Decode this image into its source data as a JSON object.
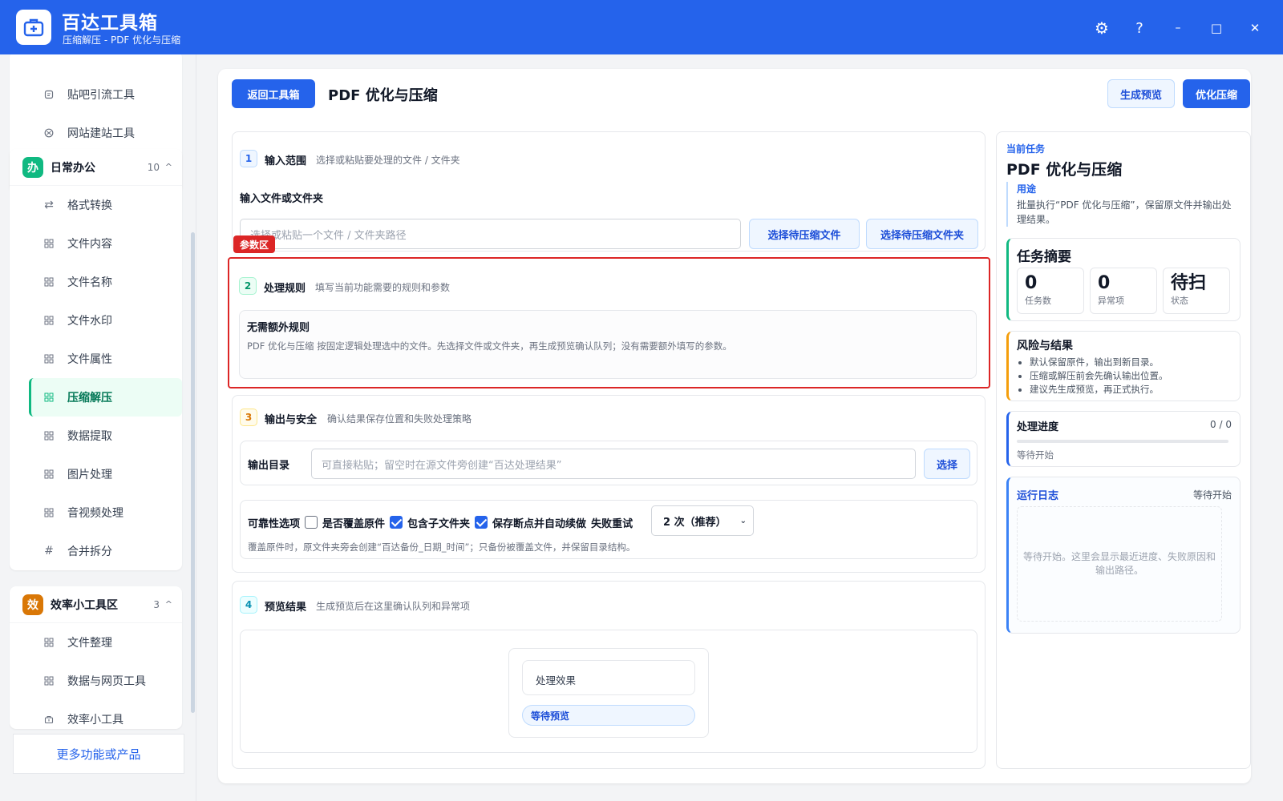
{
  "app": {
    "title": "百达工具箱",
    "subtitle": "压缩解压 - PDF 优化与压缩"
  },
  "window_controls": {
    "settings": "⚙",
    "help": "?",
    "minimize": "–",
    "maximize": "□",
    "close": "✕"
  },
  "sidebar": {
    "top_items": [
      {
        "label": "贴吧引流工具",
        "icon": "document-icon"
      },
      {
        "label": "网站建站工具",
        "icon": "globe-icon"
      }
    ],
    "groups": [
      {
        "badge": "办",
        "badge_color": "#10b981",
        "title": "日常办公",
        "count": "10",
        "chevron": "^",
        "items": [
          {
            "label": "格式转换",
            "icon": "swap-icon"
          },
          {
            "label": "文件内容",
            "icon": "grid-icon"
          },
          {
            "label": "文件名称",
            "icon": "grid-icon"
          },
          {
            "label": "文件水印",
            "icon": "grid-icon"
          },
          {
            "label": "文件属性",
            "icon": "grid-icon"
          },
          {
            "label": "压缩解压",
            "icon": "grid-icon",
            "active": true
          },
          {
            "label": "数据提取",
            "icon": "grid-icon"
          },
          {
            "label": "图片处理",
            "icon": "grid-icon"
          },
          {
            "label": "音视频处理",
            "icon": "grid-icon"
          },
          {
            "label": "合并拆分",
            "icon": "hash-icon"
          }
        ]
      },
      {
        "badge": "效",
        "badge_color": "#d97706",
        "title": "效率小工具区",
        "count": "3",
        "chevron": "^",
        "items": [
          {
            "label": "文件整理",
            "icon": "grid-icon"
          },
          {
            "label": "数据与网页工具",
            "icon": "grid-icon"
          },
          {
            "label": "效率小工具",
            "icon": "toolbox-icon"
          }
        ]
      }
    ],
    "more_label": "更多功能或产品"
  },
  "toolbar": {
    "back_label": "返回工具箱",
    "page_title": "PDF 优化与压缩",
    "preview_label": "生成预览",
    "run_label": "优化压缩"
  },
  "sections": {
    "input": {
      "num": "1",
      "title": "输入范围",
      "desc": "选择或粘贴要处理的文件 / 文件夹",
      "field_label": "输入文件或文件夹",
      "placeholder": "选择或粘贴一个文件 / 文件夹路径",
      "choose_file": "选择待压缩文件",
      "choose_folder": "选择待压缩文件夹"
    },
    "rules": {
      "tag": "参数区",
      "num": "2",
      "title": "处理规则",
      "desc": "填写当前功能需要的规则和参数",
      "box_title": "无需额外规则",
      "box_text": "PDF 优化与压缩 按固定逻辑处理选中的文件。先选择文件或文件夹，再生成预览确认队列；没有需要额外填写的参数。"
    },
    "output": {
      "num": "3",
      "title": "输出与安全",
      "desc": "确认结果保存位置和失败处理策略",
      "dir_label": "输出目录",
      "dir_placeholder": "可直接粘贴；留空时在源文件旁创建“百达处理结果”",
      "dir_button": "选择",
      "reliability_label": "可靠性选项",
      "opt_overwrite": "是否覆盖原件",
      "opt_subfolders": "包含子文件夹",
      "opt_resume": "保存断点并自动续做",
      "retry_label": "失败重试",
      "retry_value": "2 次（推荐）",
      "note": "覆盖原件时，原文件夹旁会创建“百达备份_日期_时间”；只备份被覆盖文件，并保留目录结构。"
    },
    "preview": {
      "num": "4",
      "title": "预览结果",
      "desc": "生成预览后在这里确认队列和异常项",
      "effect_label": "处理效果",
      "status_pill": "等待预览"
    }
  },
  "right": {
    "current_label": "当前任务",
    "task_title": "PDF 优化与压缩",
    "usage_label": "用途",
    "usage_text": "批量执行“PDF 优化与压缩”，保留原文件并输出处理结果。",
    "summary_title": "任务摘要",
    "metrics": [
      {
        "value": "0",
        "label": "任务数"
      },
      {
        "value": "0",
        "label": "异常项"
      },
      {
        "value": "待扫",
        "label": "状态"
      }
    ],
    "risk_title": "风险与结果",
    "risk_items": [
      "默认保留原件，输出到新目录。",
      "压缩或解压前会先确认输出位置。",
      "建议先生成预览，再正式执行。"
    ],
    "progress_title": "处理进度",
    "progress_count": "0 / 0",
    "progress_fraction": 0,
    "progress_status": "等待开始",
    "log_title": "运行日志",
    "log_status": "等待开始",
    "log_placeholder": "等待开始。这里会显示最近进度、失败原因和输出路径。"
  }
}
